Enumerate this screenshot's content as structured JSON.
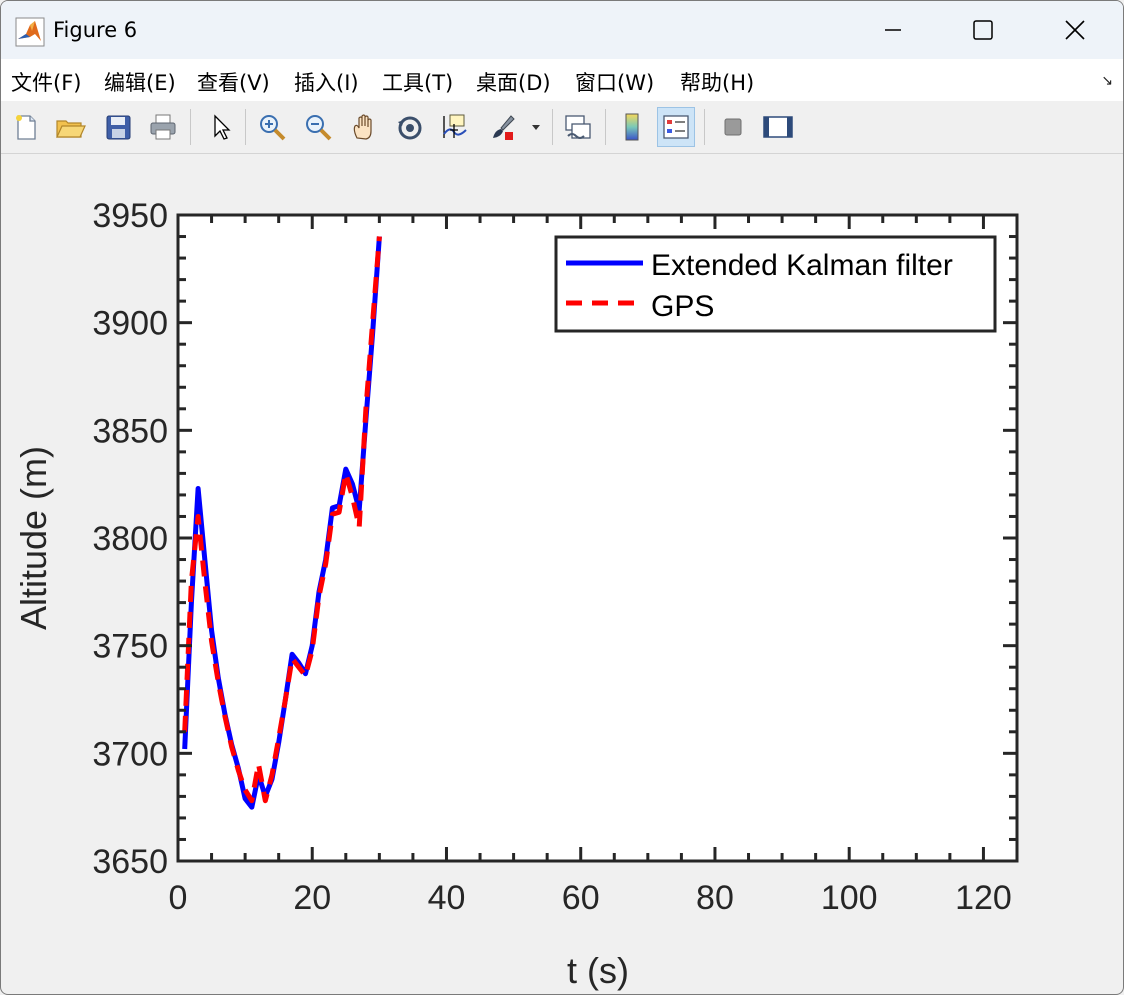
{
  "window": {
    "title": "Figure 6",
    "buttons": {
      "minimize": "minimize-icon",
      "maximize": "maximize-icon",
      "close": "close-icon"
    }
  },
  "menu": {
    "items": [
      "文件(F)",
      "编辑(E)",
      "查看(V)",
      "插入(I)",
      "工具(T)",
      "桌面(D)",
      "窗口(W)",
      "帮助(H)"
    ]
  },
  "toolbar": {
    "icons": [
      "new-figure-icon",
      "open-file-icon",
      "save-icon",
      "print-icon",
      "edit-plot-arrow-icon",
      "zoom-in-icon",
      "zoom-out-icon",
      "pan-hand-icon",
      "rotate-3d-icon",
      "data-cursor-icon",
      "brush-icon",
      "dropdown-arrow-icon",
      "link-plot-icon",
      "colorbar-icon",
      "legend-icon",
      "hide-plot-tools-icon",
      "show-plot-tools-icon"
    ]
  },
  "chart_data": {
    "type": "line",
    "title": "",
    "xlabel": "t (s)",
    "ylabel": "Altitude (m)",
    "xlim": [
      0,
      125
    ],
    "ylim": [
      3650,
      3950
    ],
    "xticks": [
      0,
      20,
      40,
      60,
      80,
      100,
      120
    ],
    "yticks": [
      3650,
      3700,
      3750,
      3800,
      3850,
      3900,
      3950
    ],
    "grid": false,
    "legend_position": "top-right",
    "series": [
      {
        "name": "Extended Kalman filter",
        "color": "#0000ff",
        "style": "solid",
        "x": [
          1,
          2,
          3,
          4,
          5,
          6,
          7,
          8,
          9,
          10,
          11,
          12,
          13,
          14,
          15,
          16,
          17,
          18,
          19,
          20,
          21,
          22,
          23,
          24,
          25,
          26,
          27,
          28,
          29,
          30
        ],
        "y": [
          3702,
          3770,
          3823,
          3790,
          3757,
          3735,
          3718,
          3704,
          3693,
          3679,
          3675,
          3690,
          3680,
          3688,
          3705,
          3725,
          3746,
          3742,
          3737,
          3750,
          3775,
          3790,
          3814,
          3815,
          3832,
          3825,
          3813,
          3855,
          3895,
          3940
        ]
      },
      {
        "name": "GPS",
        "color": "#ff0000",
        "style": "dashed",
        "x": [
          1,
          2,
          3,
          4,
          5,
          6,
          7,
          8,
          9,
          10,
          11,
          12,
          13,
          14,
          15,
          16,
          17,
          18,
          19,
          20,
          21,
          22,
          23,
          24,
          25,
          26,
          27,
          28,
          29,
          30
        ],
        "y": [
          3710,
          3780,
          3810,
          3780,
          3752,
          3733,
          3717,
          3703,
          3692,
          3683,
          3678,
          3695,
          3678,
          3690,
          3707,
          3725,
          3744,
          3740,
          3736,
          3748,
          3773,
          3788,
          3811,
          3812,
          3830,
          3819,
          3805,
          3860,
          3900,
          3940
        ]
      }
    ]
  }
}
